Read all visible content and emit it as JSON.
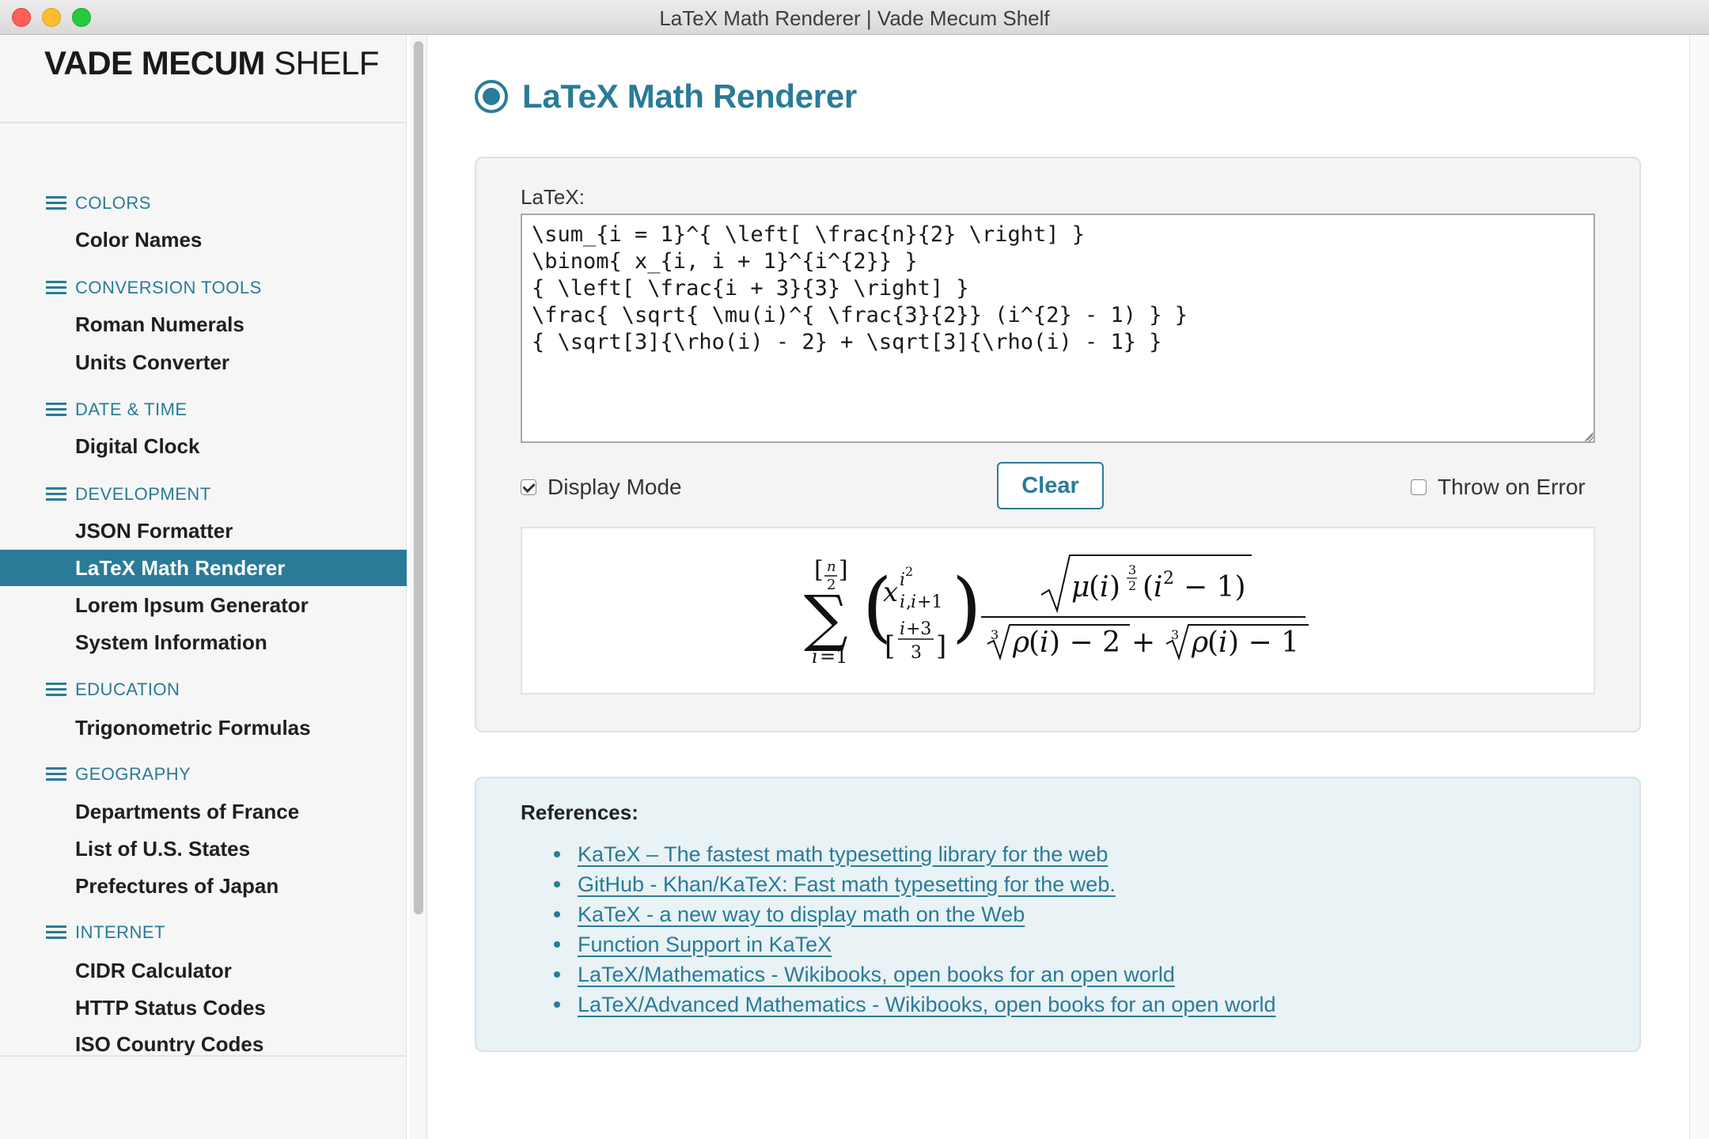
{
  "window": {
    "title": "LaTeX Math Renderer | Vade Mecum Shelf"
  },
  "brand": {
    "bold": "VADE MECUM",
    "light": "SHELF"
  },
  "sidebar": {
    "categories": [
      {
        "label": "COLORS",
        "items": [
          "Color Names"
        ]
      },
      {
        "label": "CONVERSION TOOLS",
        "items": [
          "Roman Numerals",
          "Units Converter"
        ]
      },
      {
        "label": "DATE & TIME",
        "items": [
          "Digital Clock"
        ]
      },
      {
        "label": "DEVELOPMENT",
        "items": [
          "JSON Formatter",
          "LaTeX Math Renderer",
          "Lorem Ipsum Generator",
          "System Information"
        ]
      },
      {
        "label": "EDUCATION",
        "items": [
          "Trigonometric Formulas"
        ]
      },
      {
        "label": "GEOGRAPHY",
        "items": [
          "Departments of France",
          "List of U.S. States",
          "Prefectures of Japan"
        ]
      },
      {
        "label": "INTERNET",
        "items": [
          "CIDR Calculator",
          "HTTP Status Codes",
          "ISO Country Codes"
        ]
      }
    ],
    "active_item": "LaTeX Math Renderer"
  },
  "main": {
    "title": "LaTeX Math Renderer",
    "latex_label": "LaTeX:",
    "latex_value": "\\sum_{i = 1}^{ \\left[ \\frac{n}{2} \\right] }\n\\binom{ x_{i, i + 1}^{i^{2}} }\n{ \\left[ \\frac{i + 3}{3} \\right] }\n\\frac{ \\sqrt{ \\mu(i)^{ \\frac{3}{2}} (i^{2} - 1) } }\n{ \\sqrt[3]{\\rho(i) - 2} + \\sqrt[3]{\\rho(i) - 1} }",
    "display_mode_label": "Display Mode",
    "display_mode_checked": true,
    "clear_label": "Clear",
    "throw_on_error_label": "Throw on Error",
    "throw_on_error_checked": false
  },
  "references": {
    "title": "References:",
    "links": [
      "KaTeX – The fastest math typesetting library for the web",
      "GitHub - Khan/KaTeX: Fast math typesetting for the web.",
      "KaTeX - a new way to display math on the Web",
      "Function Support in KaTeX",
      "LaTeX/Mathematics - Wikibooks, open books for an open world",
      "LaTeX/Advanced Mathematics - Wikibooks, open books for an open world"
    ]
  },
  "colors": {
    "accent": "#2a7b98",
    "sidebar_bg": "#f6f6f6",
    "refs_bg": "#e9f2f5"
  },
  "icons": {
    "category": "hamburger-menu-icon",
    "title": "radio-button-icon",
    "window_controls": [
      "close-icon",
      "minimize-icon",
      "zoom-icon"
    ]
  }
}
